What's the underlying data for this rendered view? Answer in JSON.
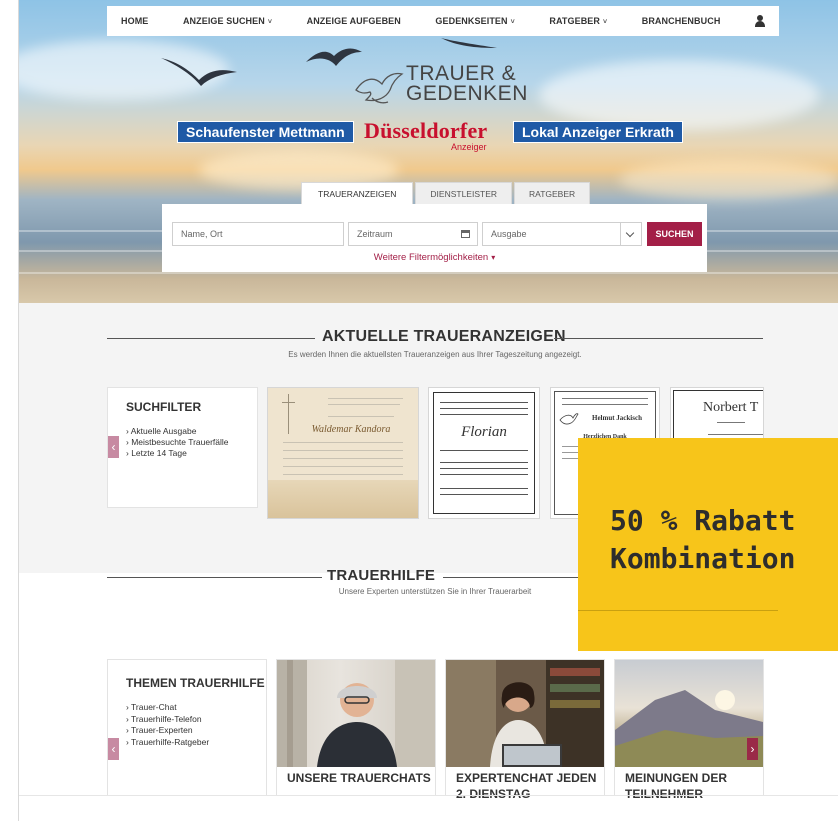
{
  "nav": {
    "items": [
      {
        "label": "HOME",
        "dropdown": false
      },
      {
        "label": "ANZEIGE SUCHEN",
        "dropdown": true
      },
      {
        "label": "ANZEIGE AUFGEBEN",
        "dropdown": false
      },
      {
        "label": "GEDENKSEITEN",
        "dropdown": true
      },
      {
        "label": "RATGEBER",
        "dropdown": true
      },
      {
        "label": "BRANCHENBUCH",
        "dropdown": false
      }
    ],
    "caret": "˅",
    "user_icon": "user-icon"
  },
  "logo": {
    "line1": "TRAUER &",
    "line2": "GEDENKEN",
    "icon": "dove-icon"
  },
  "newspapers": {
    "left": "Schaufenster Mettmann",
    "center": "Düsseldorfer",
    "center_sub": "Anzeiger",
    "right": "Lokal Anzeiger Erkrath"
  },
  "search": {
    "tabs": [
      "TRAUERANZEIGEN",
      "DIENSTLEISTER",
      "RATGEBER"
    ],
    "active_tab": 0,
    "name_placeholder": "Name, Ort",
    "date_placeholder": "Zeitraum",
    "select_value": "Ausgabe",
    "button_label": "SUCHEN",
    "more_filters": "Weitere Filtermöglichkeiten",
    "more_arrow": "▾"
  },
  "section1": {
    "title": "AKTUELLE TRAUERANZEIGEN",
    "subtitle": "Es werden Ihnen die aktuellsten Traueranzeigen aus Ihrer Tageszeitung angezeigt.",
    "filter_title": "SUCHFILTER",
    "filters": [
      "Aktuelle Ausgabe",
      "Meistbesuchte Trauerfälle",
      "Letzte 14 Tage"
    ],
    "arrow_left": "‹",
    "notices": [
      {
        "name": "Waldemar Kandora"
      },
      {
        "name": "Florian"
      },
      {
        "name": "Helmut Jackisch",
        "sub": "Herzlichen Dank"
      },
      {
        "name": "Norbert T"
      }
    ]
  },
  "section2": {
    "title": "TRAUERHILFE",
    "subtitle": "Unsere Experten unterstützen Sie in Ihrer Trauerarbeit",
    "theme_title": "THEMEN TRAUERHILFE",
    "themes": [
      "Trauer-Chat",
      "Trauerhilfe-Telefon",
      "Trauer-Experten",
      "Trauerhilfe-Ratgeber"
    ],
    "arrow_left": "‹",
    "arrow_right": "›",
    "cards": [
      {
        "label": "UNSERE TRAUERCHATS"
      },
      {
        "label": "EXPERTENCHAT JEDEN 2. DIENSTAG"
      },
      {
        "label": "MEINUNGEN DER TEILNEHMER"
      }
    ]
  },
  "promo": {
    "line1": "50 % Rabatt",
    "line2": "Kombination",
    "color": "#f7c51a"
  },
  "colors": {
    "accent": "#a31f47",
    "blue": "#1f5aa6",
    "red": "#c8102e"
  }
}
